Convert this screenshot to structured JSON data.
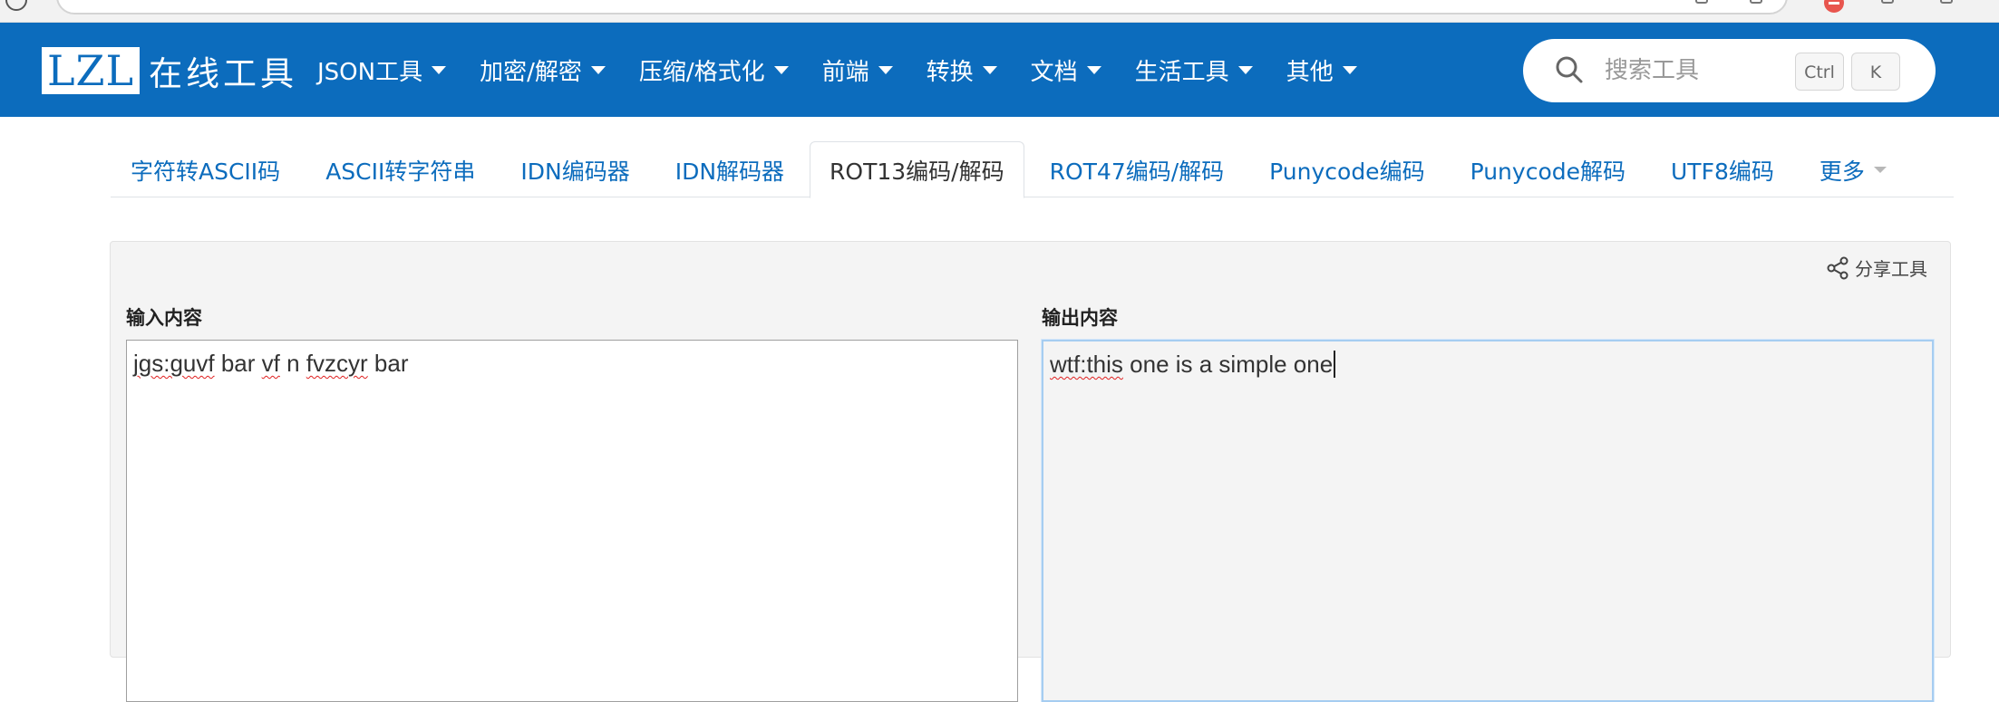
{
  "logo": {
    "mark": "LZL",
    "text": "在线工具"
  },
  "nav": {
    "items": [
      {
        "label": "JSON工具"
      },
      {
        "label": "加密/解密"
      },
      {
        "label": "压缩/格式化"
      },
      {
        "label": "前端"
      },
      {
        "label": "转换"
      },
      {
        "label": "文档"
      },
      {
        "label": "生活工具"
      },
      {
        "label": "其他"
      }
    ]
  },
  "search": {
    "placeholder": "搜索工具",
    "shortcut_ctrl": "Ctrl",
    "shortcut_key": "K"
  },
  "tabs": [
    {
      "label": "字符转ASCII码"
    },
    {
      "label": "ASCII转字符串"
    },
    {
      "label": "IDN编码器"
    },
    {
      "label": "IDN解码器"
    },
    {
      "label": "ROT13编码/解码"
    },
    {
      "label": "ROT47编码/解码"
    },
    {
      "label": "Punycode编码"
    },
    {
      "label": "Punycode解码"
    },
    {
      "label": "UTF8编码"
    },
    {
      "label": "更多"
    }
  ],
  "tool": {
    "share_label": "分享工具",
    "input_label": "输入内容",
    "output_label": "输出内容",
    "input": {
      "w1": "jgs:guvf",
      "s1": " bar ",
      "w2": "vf",
      "s2": " n ",
      "w3": "fvzcyr",
      "s3": " bar"
    },
    "output": {
      "w1": "wtf:this",
      "rest": " one is a simple one"
    }
  },
  "colors": {
    "navbar": "#0c6cbd",
    "link": "#0c6cbd",
    "card_bg": "#f4f4f4",
    "output_border": "#a6cdf1",
    "spellcheck": "#e02020"
  }
}
